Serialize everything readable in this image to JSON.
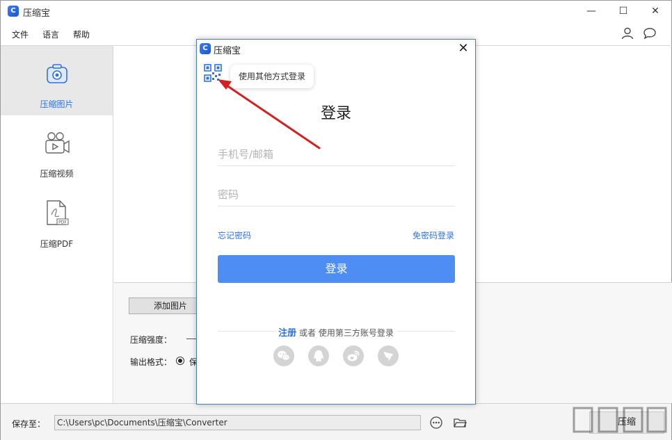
{
  "app": {
    "title": "压缩宝",
    "logo_letter": "C",
    "window_controls": {
      "minimize": "—",
      "maximize": "☐",
      "close": "✕"
    }
  },
  "menu": {
    "items": [
      "文件",
      "语言",
      "帮助"
    ],
    "right_icons": [
      "user-icon",
      "chat-icon"
    ]
  },
  "sidebar": {
    "items": [
      {
        "label": "压缩图片",
        "icon": "camera-icon",
        "active": true
      },
      {
        "label": "压缩视频",
        "icon": "video-camera-icon",
        "active": false
      },
      {
        "label": "压缩PDF",
        "icon": "pdf-file-icon",
        "active": false
      }
    ]
  },
  "panel": {
    "add_button": "添加图片",
    "strength_label": "压缩强度：",
    "format_label": "输出格式：",
    "format_option": "保"
  },
  "footer": {
    "save_label": "保存至：",
    "path": "C:\\Users\\pc\\Documents\\压缩宝\\Converter",
    "more_icon": "more-icon",
    "folder_icon": "folder-icon",
    "compress_button": "压缩"
  },
  "dialog": {
    "title": "压缩宝",
    "close": "✕",
    "tooltip": "使用其他方式登录",
    "heading": "登录",
    "phone_placeholder": "手机号/邮箱",
    "password_placeholder": "密码",
    "forgot_link": "忘记密码",
    "passwordless_link": "免密码登录",
    "login_button": "登录",
    "register": "注册",
    "third_party_text": " 或者 使用第三方账号登录",
    "social_icons": [
      "wechat-icon",
      "qq-icon",
      "weibo-icon",
      "dingtalk-icon"
    ]
  },
  "colors": {
    "accent": "#2f73e0",
    "login_button": "#4e8ef4",
    "arrow": "#d42020",
    "social_bg": "#d4d4d4"
  }
}
